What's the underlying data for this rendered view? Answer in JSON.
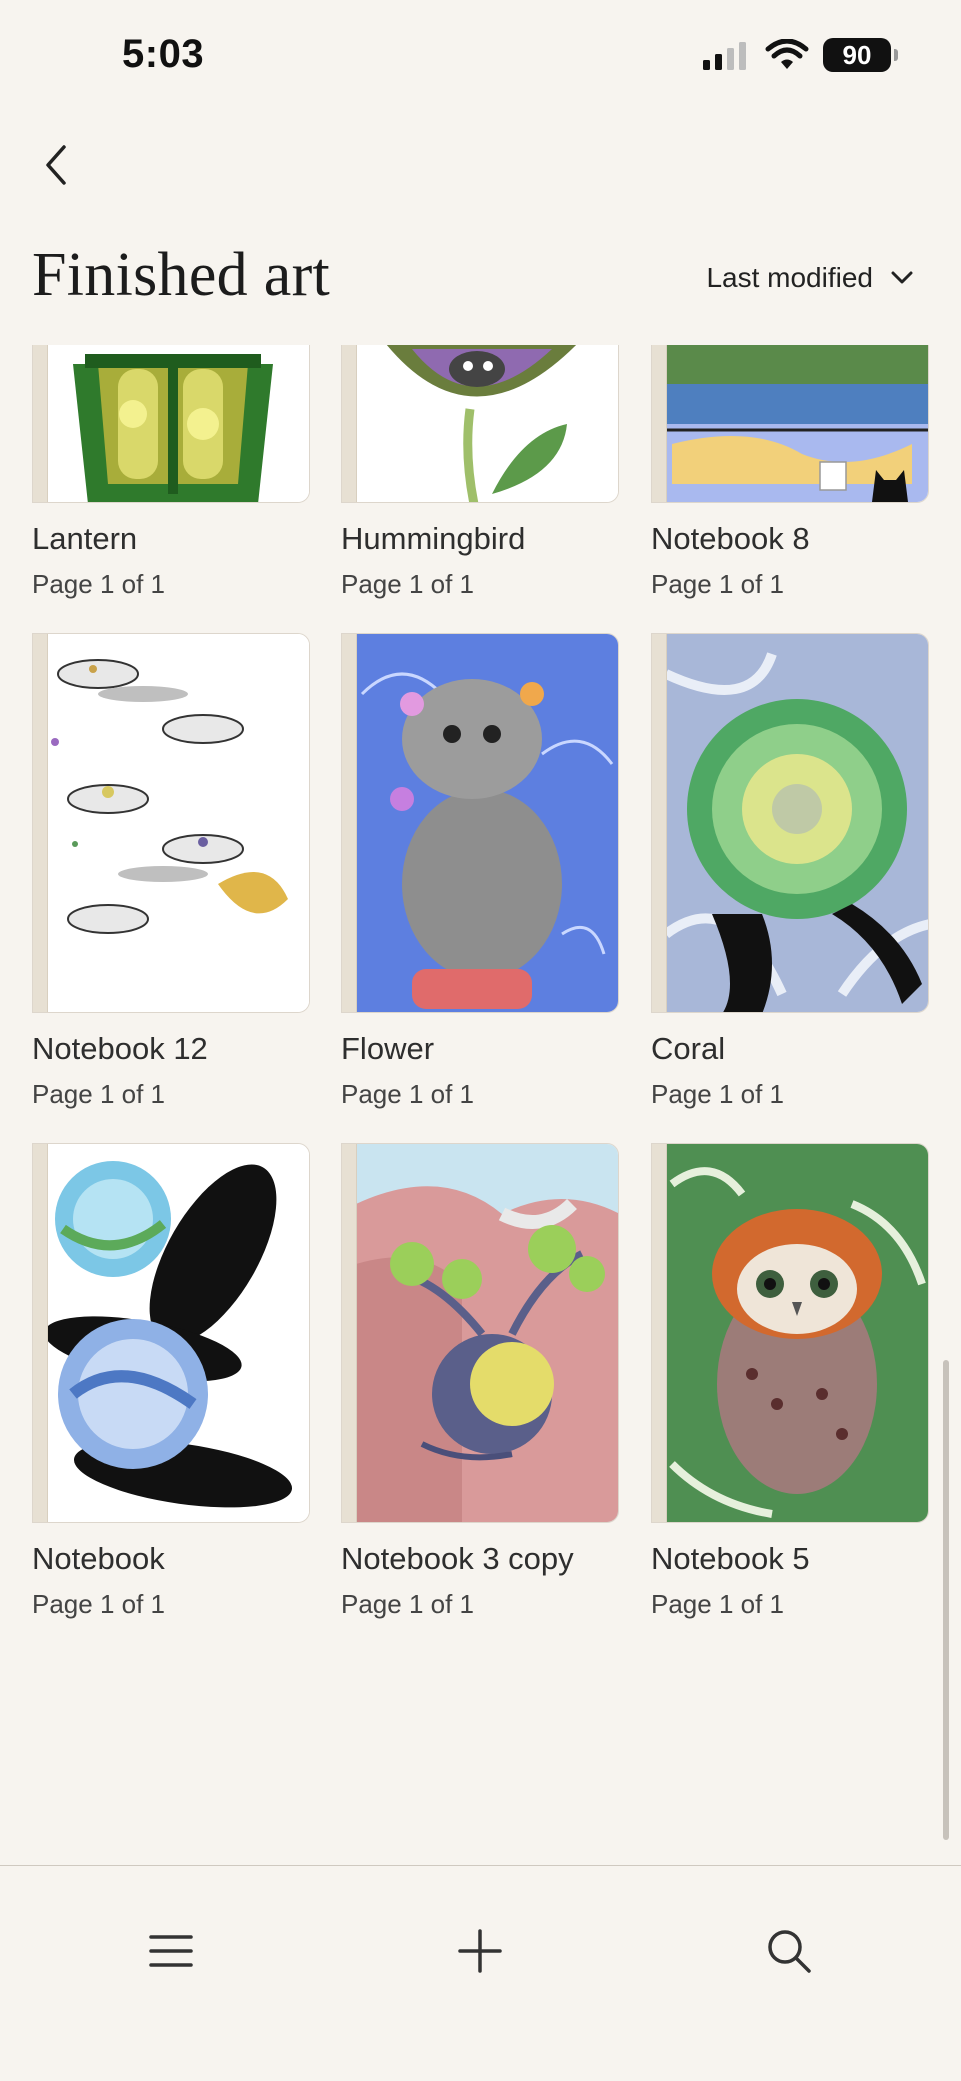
{
  "status": {
    "time": "5:03",
    "battery": "90"
  },
  "header": {
    "title": "Finished art",
    "sort_label": "Last modified"
  },
  "notebooks": [
    {
      "title": "Lantern",
      "pages": "Page 1 of 1"
    },
    {
      "title": "Hummingbird",
      "pages": "Page 1 of 1"
    },
    {
      "title": "Notebook 8",
      "pages": "Page 1 of 1"
    },
    {
      "title": "Notebook 12",
      "pages": "Page 1 of 1"
    },
    {
      "title": "Flower",
      "pages": "Page 1 of 1"
    },
    {
      "title": "Coral",
      "pages": "Page 1 of 1"
    },
    {
      "title": "Notebook",
      "pages": "Page 1 of 1"
    },
    {
      "title": "Notebook 3 copy",
      "pages": "Page 1 of 1"
    },
    {
      "title": "Notebook 5",
      "pages": "Page 1 of 1"
    }
  ],
  "toolbar": {
    "menu_icon": "menu-icon",
    "add_icon": "plus-icon",
    "search_icon": "search-icon"
  }
}
